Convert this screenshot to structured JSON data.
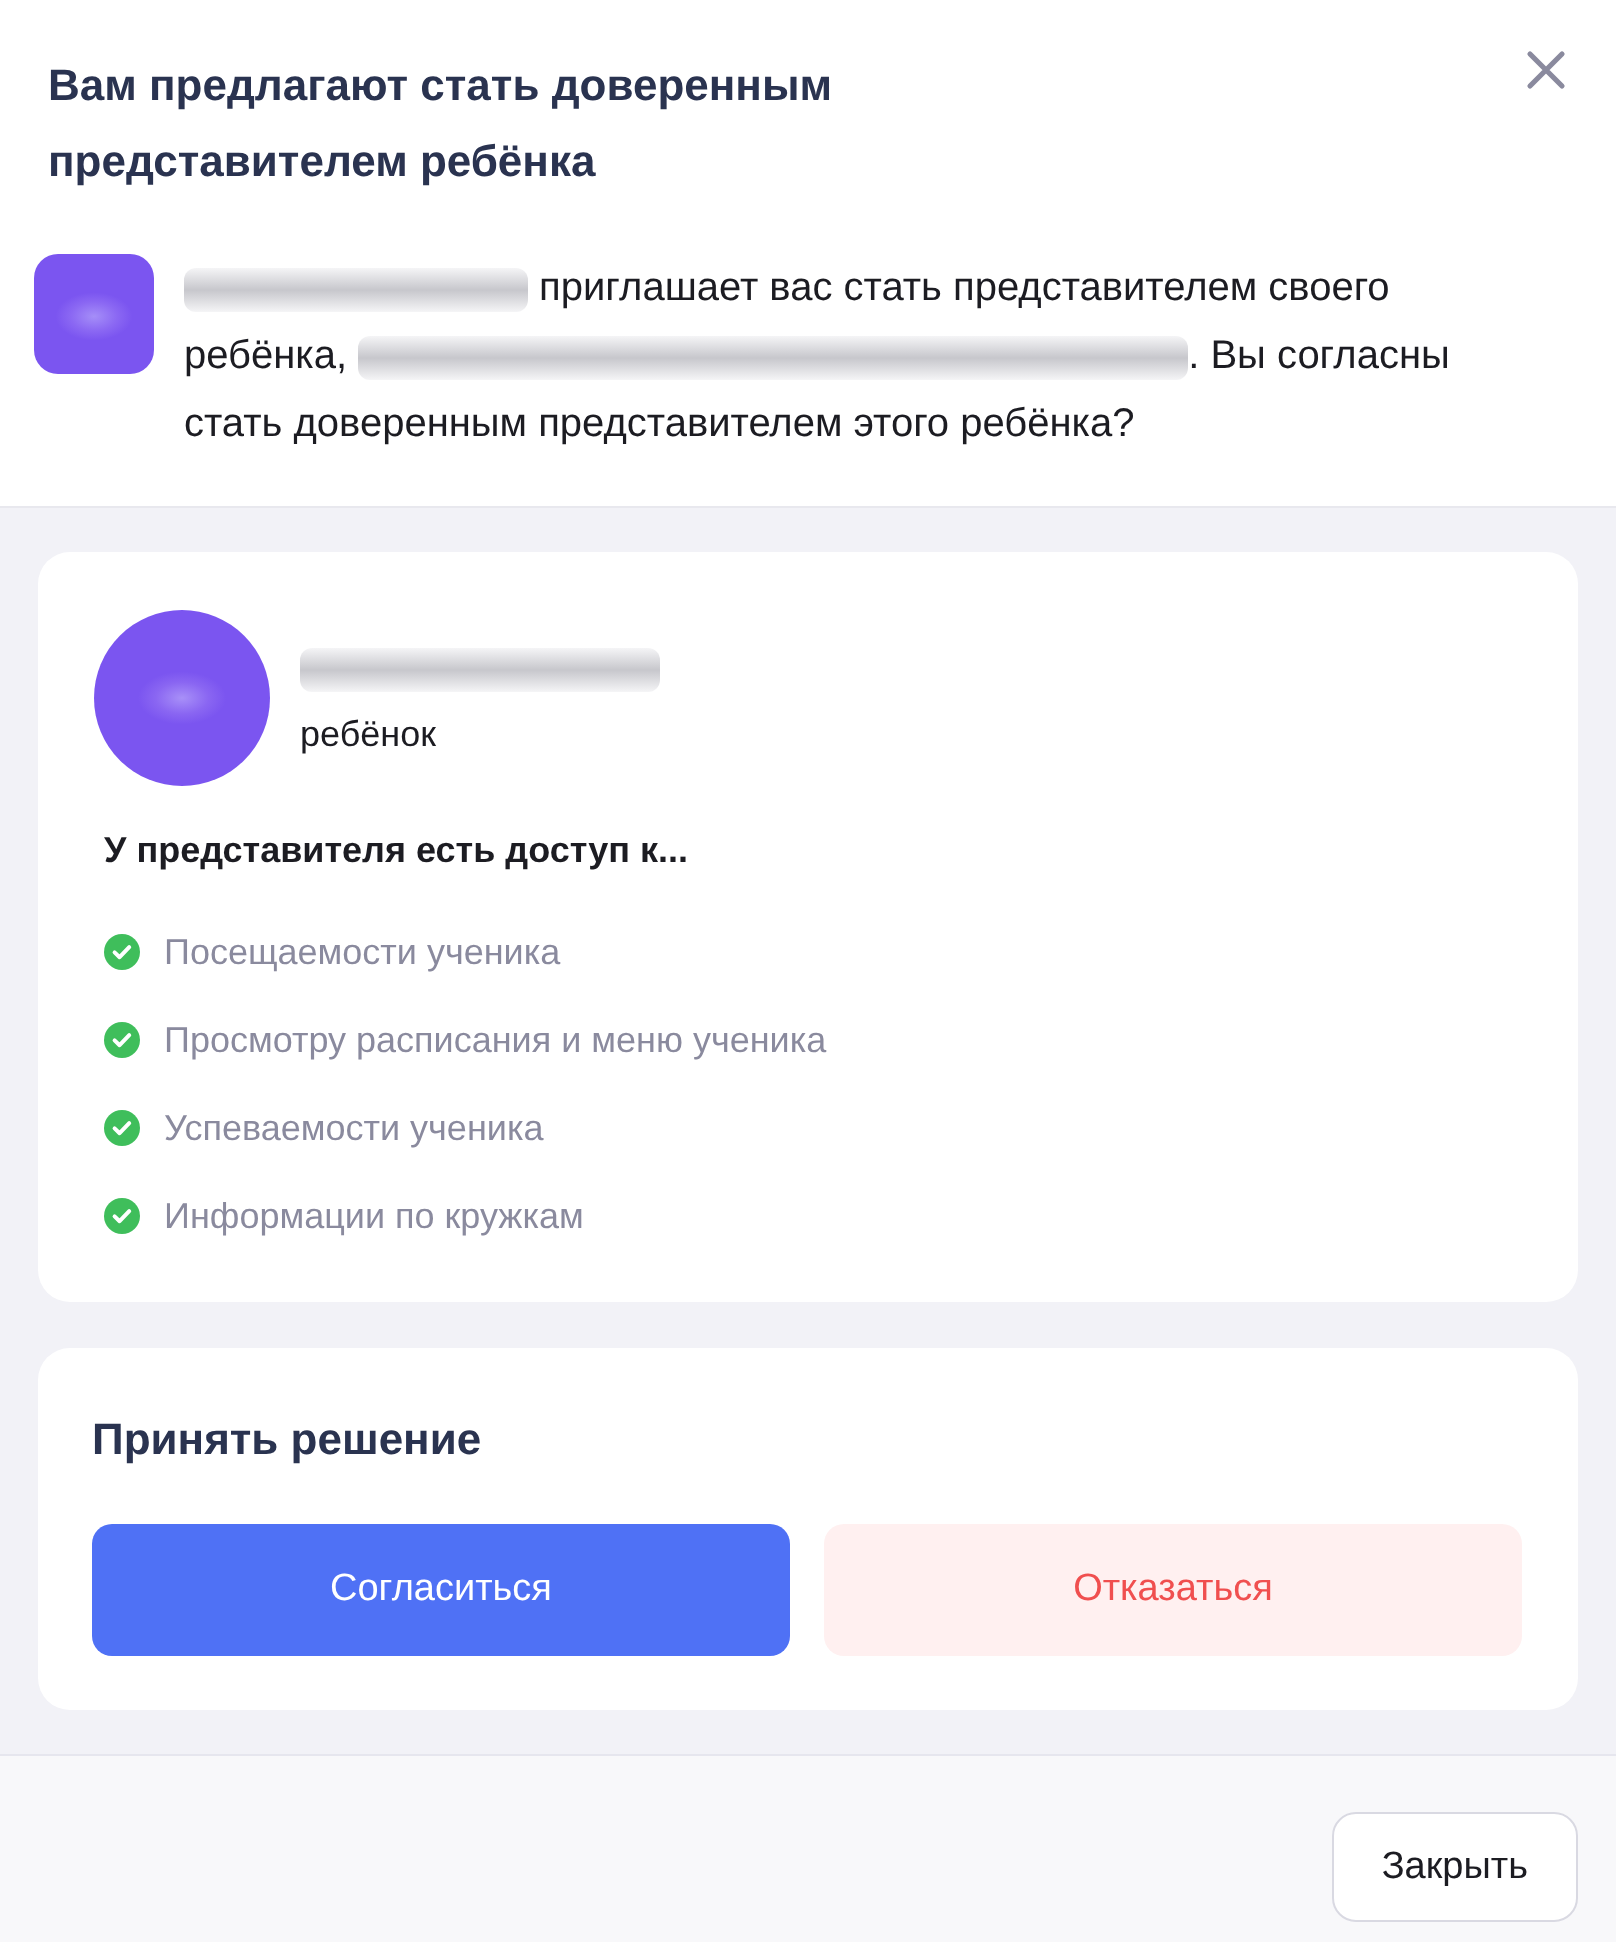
{
  "dialog": {
    "title": "Вам предлагают стать доверенным представителем ребёнка"
  },
  "invitation": [
    {
      "kind": "redacted-name"
    },
    {
      "kind": "text",
      "text": " приглашает вас стать представителем своего ребёнка, "
    },
    {
      "kind": "redacted-details"
    },
    {
      "kind": "text",
      "text": ". Вы согласны стать доверенным представителем этого ребёнка?"
    }
  ],
  "child_card": {
    "role": "ребёнок",
    "access_heading": "У представителя есть доступ к...",
    "access_items": [
      {
        "label": "Посещаемости ученика",
        "checked": true
      },
      {
        "label": "Просмотру расписания и меню ученика",
        "checked": true
      },
      {
        "label": "Успеваемости ученика",
        "checked": true
      },
      {
        "label": "Информации по кружкам",
        "checked": true
      }
    ]
  },
  "decision": {
    "title": "Принять решение",
    "buttons": [
      {
        "label": "Согласиться",
        "kind": "primary"
      },
      {
        "label": "Отказаться",
        "kind": "danger"
      }
    ]
  },
  "footer": {
    "buttons": [
      {
        "label": "Закрыть"
      }
    ]
  }
}
